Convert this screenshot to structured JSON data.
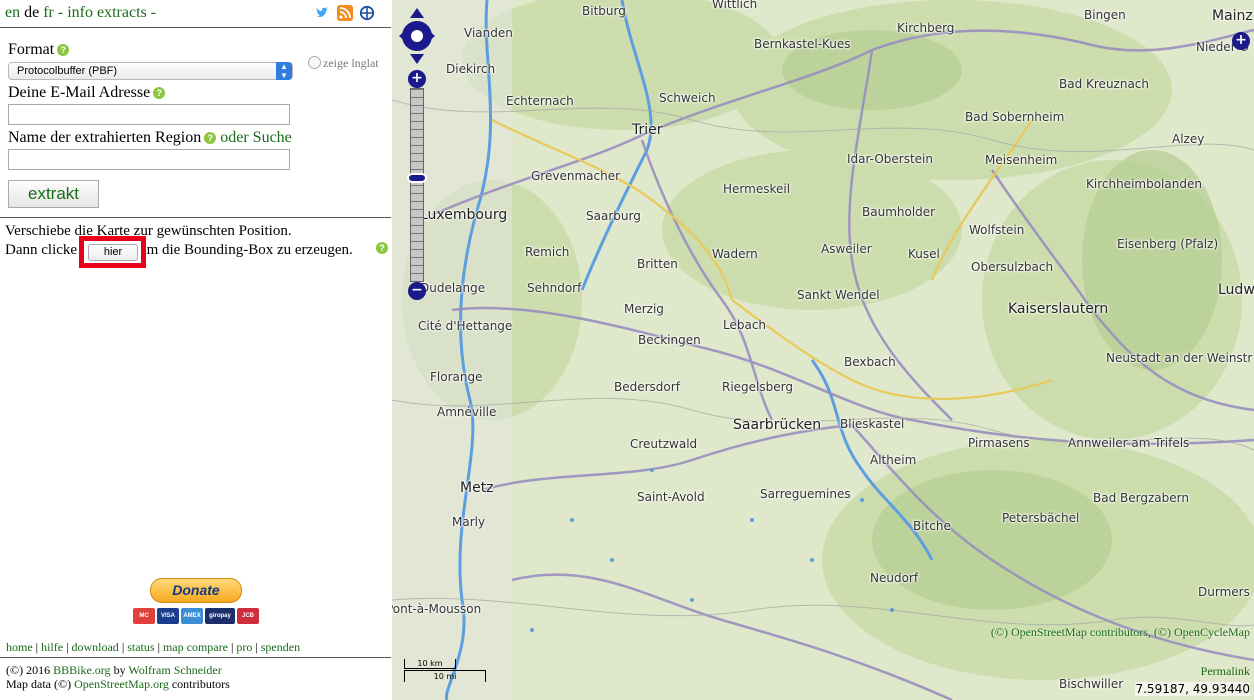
{
  "lang": {
    "en": "en",
    "de": "de",
    "fr": "fr",
    "sep1": " ",
    "sep2": " - ",
    "info": "info",
    "extracts": "extracts",
    "dash": "-"
  },
  "form": {
    "format_label": "Format",
    "format_value": "Protocolbuffer (PBF)",
    "latlng_label": "zeige lnglat",
    "email_label": "Deine E-Mail Adresse",
    "email_value": "",
    "region_label": "Name der extrahierten Region",
    "region_or_search": "oder Suche",
    "region_value": "",
    "extract_button": "extrakt"
  },
  "instructions": {
    "line1": "Verschiebe die Karte zur gewünschten Position.",
    "line2_start": "Dann clicke",
    "hier_button": "hier",
    "line2_end": "um die Bounding-Box zu erzeugen."
  },
  "donate": {
    "label": "Donate",
    "cards": [
      "MC",
      "VISA",
      "AMEX",
      "giropay",
      "JCB"
    ]
  },
  "footer": {
    "links": [
      "home",
      "hilfe",
      "download",
      "status",
      "map compare",
      "pro",
      "spenden"
    ],
    "copyright_prefix": "(©) 2016",
    "bbbike": "BBBike.org",
    "by": "by",
    "author": "Wolfram Schneider",
    "mapdata_prefix": "Map data (©)",
    "osm": "OpenStreetMap.org",
    "contributors": "contributors"
  },
  "map": {
    "zoom_in": "+",
    "zoom_out": "−",
    "layer_switch": "+",
    "attribution": "(©) OpenStreetMap contributors, (©) OpenCycleMap",
    "permalink": "Permalink",
    "coords": "7.59187, 49.93440",
    "scale_km": "10 km",
    "scale_mi": "10 mi",
    "places": [
      "Bitburg",
      "Wittlich",
      "Bingen",
      "Mainz",
      "Vianden",
      "Bernkastel-Kues",
      "Kirchberg",
      "Nieder-O",
      "Diekirch",
      "Bad Kreuznach",
      "Echternach",
      "Schweich",
      "Trier",
      "Bad Sobernheim",
      "Alzey",
      "Idar-Oberstein",
      "Meisenheim",
      "Grevenmacher",
      "Hermeskeil",
      "Kirchheimbolanden",
      "Luxembourg",
      "Saarburg",
      "Baumholder",
      "Remich",
      "Wadern",
      "Asweiler",
      "Kusel",
      "Wolfstein",
      "Eisenberg (Pfalz)",
      "Britten",
      "Obersulzbach",
      "Dudelange",
      "Sehndorf",
      "Sankt Wendel",
      "Ludw",
      "Merzig",
      "Lebach",
      "Kaiserslautern",
      "Cité d'Hettange",
      "Beckingen",
      "Bexbach",
      "Neustadt an der Weinstr",
      "Florange",
      "Bedersdorf",
      "Riegelsberg",
      "Amnéville",
      "Saarbrücken",
      "Blieskastel",
      "Pirmasens",
      "Annweiler am Trifels",
      "Creutzwald",
      "Altheim",
      "Metz",
      "Saint-Avold",
      "Sarreguemines",
      "Bad Bergzabern",
      "Marly",
      "Petersbächel",
      "Bitche",
      "Neudorf",
      "Durmers",
      "Pont-à-Mousson",
      "Bischwiller"
    ]
  }
}
